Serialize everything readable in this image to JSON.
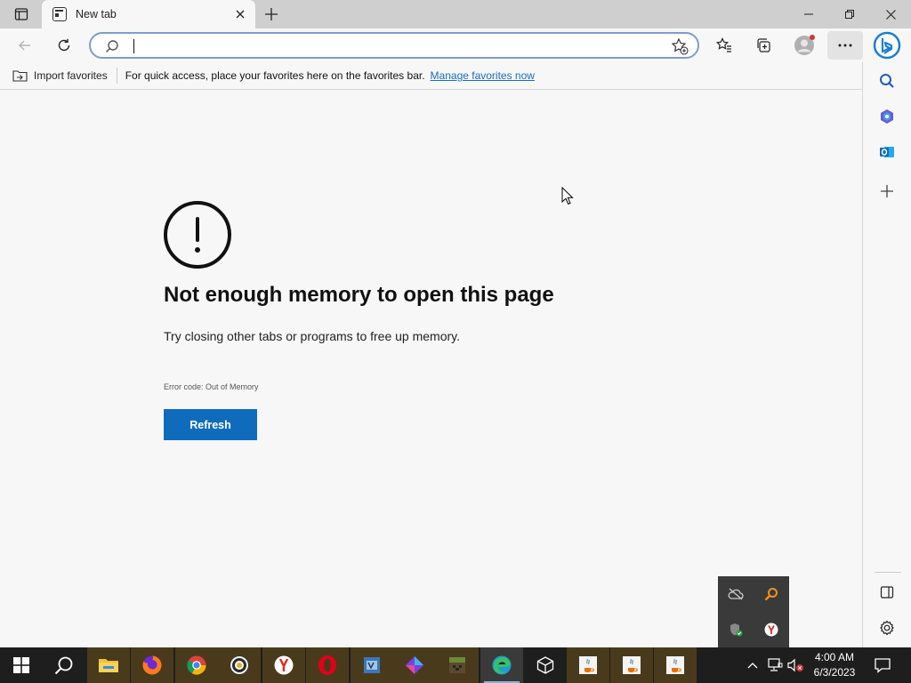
{
  "browser": {
    "tab_title": "New tab",
    "address_value": "",
    "address_placeholder": ""
  },
  "favorites_bar": {
    "import_label": "Import favorites",
    "prompt_text": "For quick access, place your favorites here on the favorites bar.",
    "manage_link": "Manage favorites now"
  },
  "error_page": {
    "title": "Not enough memory to open this page",
    "description": "Try closing other tabs or programs to free up memory.",
    "error_code": "Error code: Out of Memory",
    "refresh_label": "Refresh"
  },
  "sidebar": {
    "items": [
      "search-icon",
      "copilot-icon",
      "outlook-icon",
      "add-icon",
      "split-screen-icon",
      "settings-icon"
    ]
  },
  "taskbar": {
    "apps": [
      "start-icon",
      "search-icon",
      "file-explorer-icon",
      "firefox-icon",
      "chrome-icon",
      "brave-icon",
      "yandex-icon",
      "opera-icon",
      "visual-studio-icon",
      "affinity-icon",
      "minecraft-icon",
      "edge-icon",
      "package-icon",
      "java-icon",
      "java-icon",
      "java-icon"
    ],
    "time": "4:00 AM",
    "date": "6/3/2023"
  },
  "colors": {
    "accent": "#0f6cbd",
    "link": "#1a6bc2",
    "taskbar": "#1e1e1e"
  }
}
